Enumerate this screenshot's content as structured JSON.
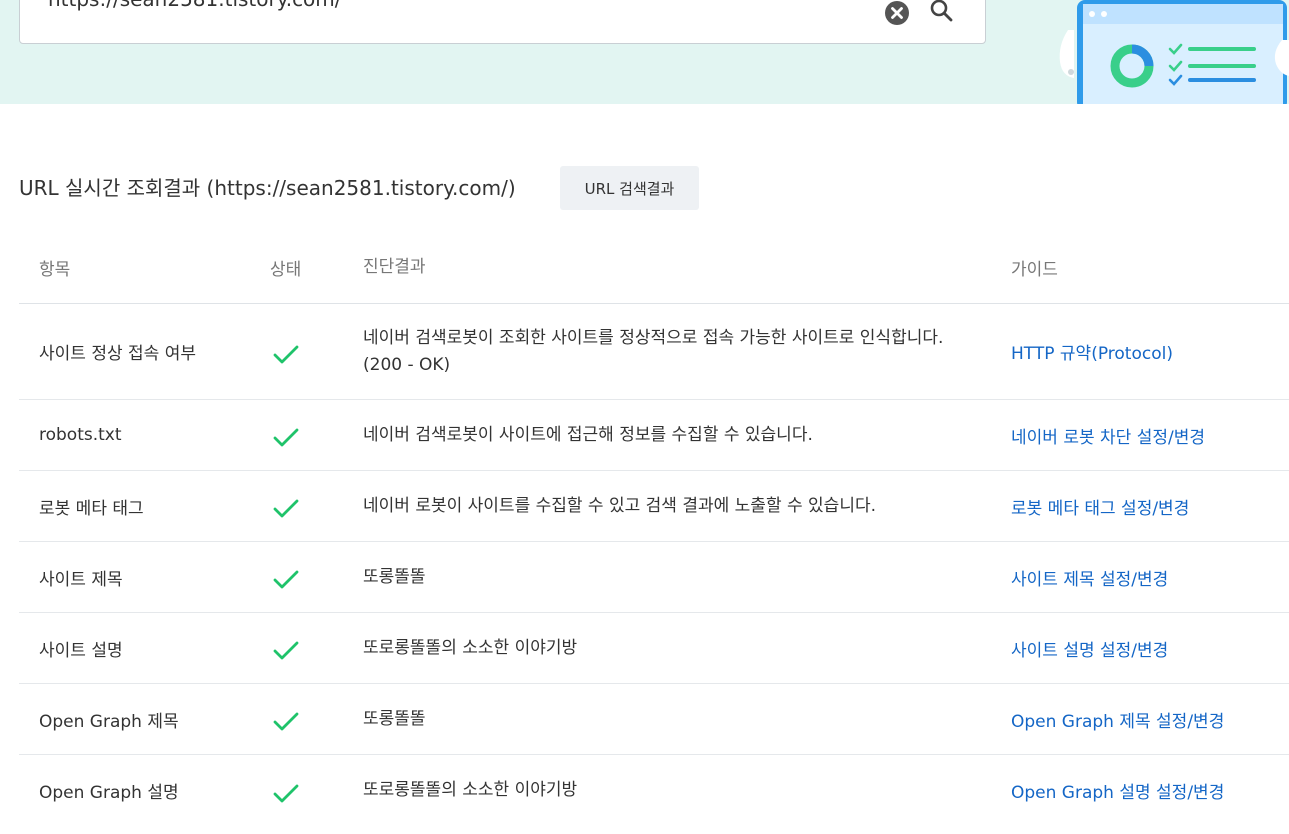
{
  "search": {
    "url_value": "https://sean2581.tistory.com/"
  },
  "result": {
    "title": "URL 실시간 조회결과 (https://sean2581.tistory.com/)",
    "url_result_button": "URL 검색결과"
  },
  "table": {
    "headers": {
      "item": "항목",
      "status": "상태",
      "result": "진단결과",
      "guide": "가이드"
    },
    "rows": [
      {
        "item": "사이트 정상 접속 여부",
        "status": "ok",
        "result_line1": "네이버 검색로봇이 조회한 사이트를 정상적으로 접속 가능한 사이트로 인식합니다.",
        "result_line2": "(200 - OK)",
        "guide": "HTTP 규약(Protocol)"
      },
      {
        "item": "robots.txt",
        "status": "ok",
        "result_line1": "네이버 검색로봇이 사이트에 접근해 정보를 수집할 수 있습니다.",
        "guide": "네이버 로봇 차단 설정/변경"
      },
      {
        "item": "로봇 메타 태그",
        "status": "ok",
        "result_line1": "네이버 로봇이 사이트를 수집할 수 있고 검색 결과에 노출할 수 있습니다.",
        "guide": "로봇 메타 태그 설정/변경"
      },
      {
        "item": "사이트 제목",
        "status": "ok",
        "result_line1": "또롱똘똘",
        "guide": "사이트 제목 설정/변경"
      },
      {
        "item": "사이트 설명",
        "status": "ok",
        "result_line1": "또로롱똘똘의 소소한 이야기방",
        "guide": "사이트 설명 설정/변경"
      },
      {
        "item": "Open Graph 제목",
        "status": "ok",
        "result_line1": "또롱똘똘",
        "guide": "Open Graph 제목 설정/변경"
      },
      {
        "item": "Open Graph 설명",
        "status": "ok",
        "result_line1": "또로롱똘똘의 소소한 이야기방",
        "guide": "Open Graph 설명 설정/변경"
      }
    ]
  },
  "colors": {
    "band": "#e2f5f2",
    "check": "#1fc36a",
    "link": "#1466c6"
  },
  "icons": {
    "clear": "clear-circle-icon",
    "search": "search-icon",
    "status_ok": "check-icon"
  }
}
